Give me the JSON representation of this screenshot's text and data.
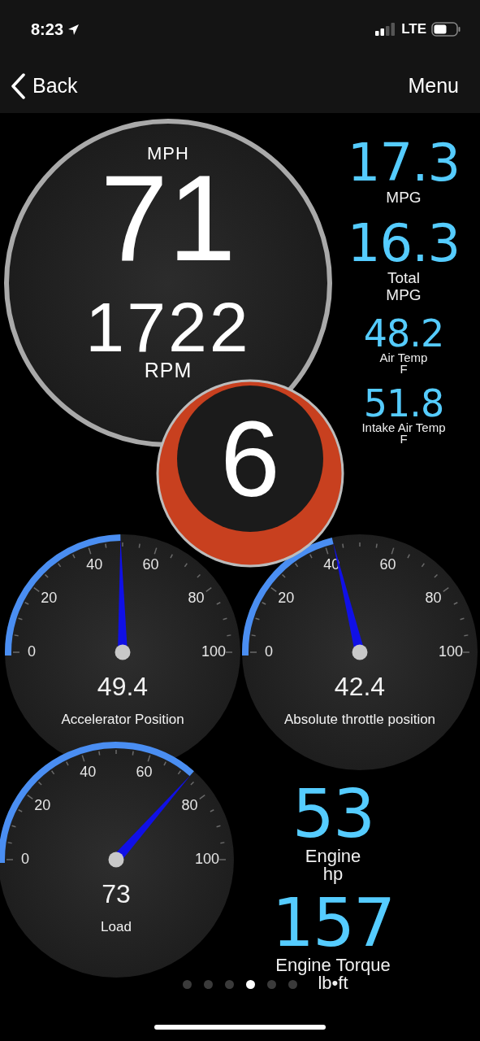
{
  "status_bar": {
    "time": "8:23",
    "network": "LTE"
  },
  "nav": {
    "back": "Back",
    "menu": "Menu"
  },
  "speedometer": {
    "unit": "MPH",
    "speed": "71",
    "rpm": "1722",
    "rpm_unit": "RPM"
  },
  "gear": {
    "value": "6"
  },
  "side_readouts": [
    {
      "value": "17.3",
      "label_lines": [
        "MPG"
      ],
      "kind": "large"
    },
    {
      "value": "16.3",
      "label_lines": [
        "Total",
        "MPG"
      ],
      "kind": "large"
    },
    {
      "value": "48.2",
      "label_lines": [
        "Air Temp",
        "F"
      ],
      "kind": "small"
    },
    {
      "value": "51.8",
      "label_lines": [
        "Intake Air Temp",
        "F"
      ],
      "kind": "small"
    }
  ],
  "gauges": [
    {
      "value": "49.4",
      "label": "Accelerator Position",
      "ticks": [
        "0",
        "20",
        "40",
        "60",
        "80",
        "100"
      ]
    },
    {
      "value": "42.4",
      "label": "Absolute throttle position",
      "ticks": [
        "0",
        "20",
        "40",
        "60",
        "80",
        "100"
      ]
    },
    {
      "value": "73",
      "label": "Load",
      "ticks": [
        "0",
        "20",
        "40",
        "60",
        "80",
        "100"
      ]
    }
  ],
  "bottom_readouts": [
    {
      "value": "53",
      "label_lines": [
        "Engine",
        "hp"
      ],
      "kind": "xlarge"
    },
    {
      "value": "157",
      "label_lines": [
        "Engine Torque",
        "lb•ft"
      ],
      "kind": "xlarge"
    }
  ],
  "page_dots": [
    {
      "selected": false
    },
    {
      "selected": false
    },
    {
      "selected": false
    },
    {
      "selected": true
    },
    {
      "selected": false
    },
    {
      "selected": false
    }
  ]
}
